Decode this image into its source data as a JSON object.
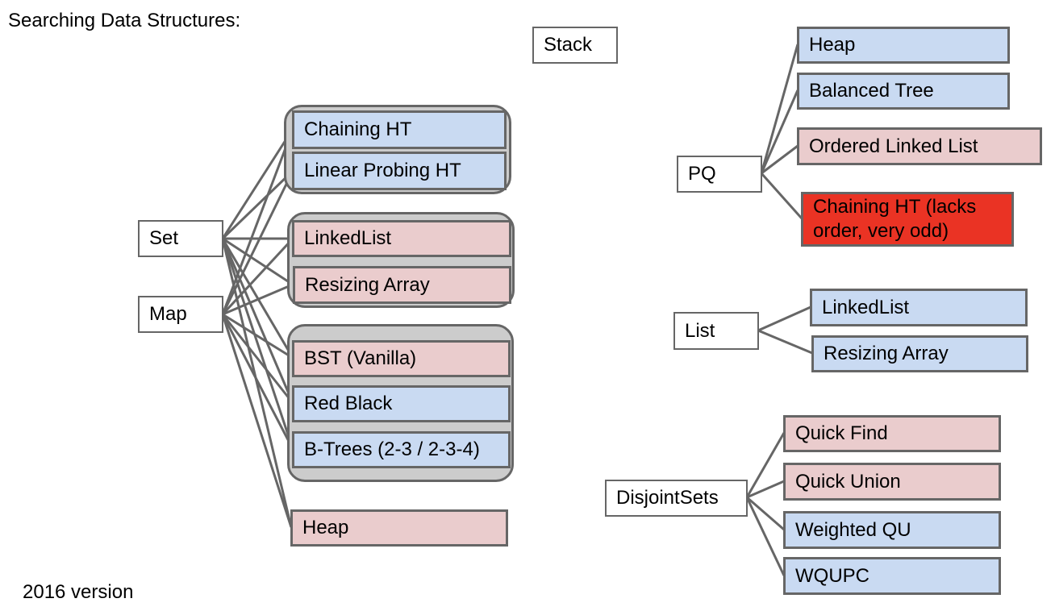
{
  "title": "Searching Data Structures:",
  "footer": "2016 version",
  "colors": {
    "good": "#c9daf2",
    "bad": "#eacccd",
    "awful": "#ea3324",
    "group_fill": "#cccccc",
    "edge": "#666666"
  },
  "abstract_types": {
    "stack": "Stack",
    "set": "Set",
    "map": "Map",
    "pq": "PQ",
    "list": "List",
    "disjoint_sets": "DisjointSets"
  },
  "set_map_impls": {
    "hash_group": [
      {
        "label": "Chaining HT",
        "rating": "good"
      },
      {
        "label": "Linear Probing HT",
        "rating": "good"
      }
    ],
    "list_group": [
      {
        "label": "LinkedList",
        "rating": "bad"
      },
      {
        "label": "Resizing Array",
        "rating": "bad"
      }
    ],
    "tree_group": [
      {
        "label": "BST (Vanilla)",
        "rating": "bad"
      },
      {
        "label": "Red Black",
        "rating": "good"
      },
      {
        "label": "B-Trees (2-3 / 2-3-4)",
        "rating": "good"
      }
    ],
    "heap": {
      "label": "Heap",
      "rating": "bad"
    }
  },
  "pq_impls": [
    {
      "label": "Heap",
      "rating": "good"
    },
    {
      "label": "Balanced Tree",
      "rating": "good"
    },
    {
      "label": "Ordered Linked List",
      "rating": "bad"
    },
    {
      "label": "Chaining HT (lacks order, very odd)",
      "rating": "awful"
    }
  ],
  "list_impls": [
    {
      "label": "LinkedList",
      "rating": "good"
    },
    {
      "label": "Resizing Array",
      "rating": "good"
    }
  ],
  "disjoint_sets_impls": [
    {
      "label": "Quick Find",
      "rating": "bad"
    },
    {
      "label": "Quick Union",
      "rating": "bad"
    },
    {
      "label": "Weighted QU",
      "rating": "good"
    },
    {
      "label": "WQUPC",
      "rating": "good"
    }
  ],
  "edges": [
    {
      "from": "Set",
      "to": [
        "Chaining HT",
        "Linear Probing HT",
        "LinkedList",
        "Resizing Array",
        "BST (Vanilla)",
        "Red Black",
        "B-Trees (2-3 / 2-3-4)",
        "Heap"
      ]
    },
    {
      "from": "Map",
      "to": [
        "Chaining HT",
        "Linear Probing HT",
        "LinkedList",
        "Resizing Array",
        "BST (Vanilla)",
        "Red Black",
        "B-Trees (2-3 / 2-3-4)",
        "Heap"
      ]
    },
    {
      "from": "PQ",
      "to": [
        "Heap",
        "Balanced Tree",
        "Ordered Linked List",
        "Chaining HT (lacks order, very odd)"
      ]
    },
    {
      "from": "List",
      "to": [
        "LinkedList",
        "Resizing Array"
      ]
    },
    {
      "from": "DisjointSets",
      "to": [
        "Quick Find",
        "Quick Union",
        "Weighted QU",
        "WQUPC"
      ]
    }
  ]
}
